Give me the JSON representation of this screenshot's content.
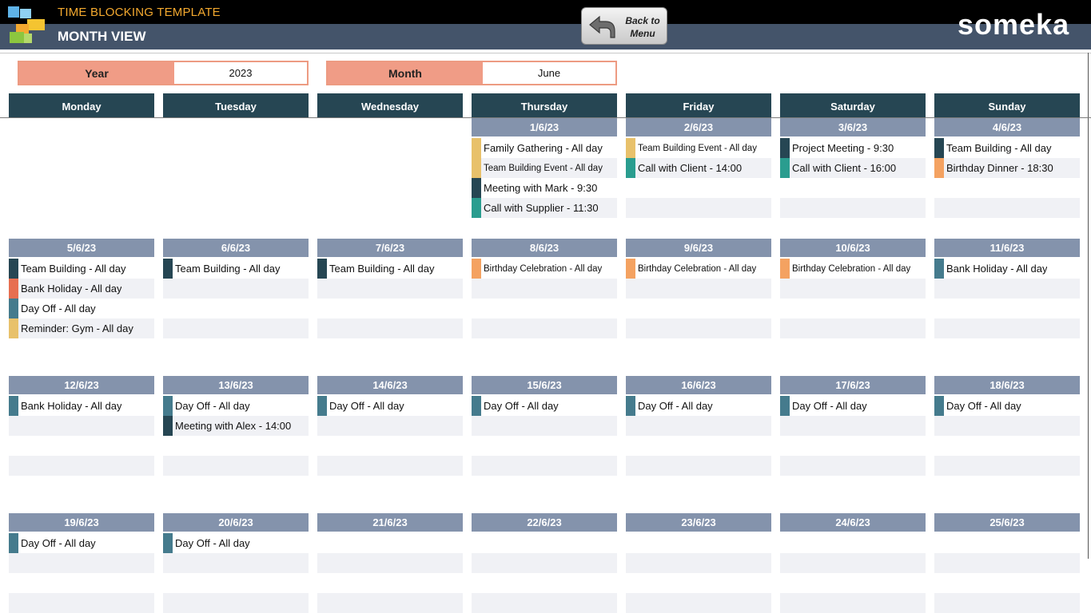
{
  "header": {
    "app_title": "TIME BLOCKING TEMPLATE",
    "view_title": "MONTH VIEW",
    "back_button_line1": "Back to",
    "back_button_line2": "Menu",
    "brand": "someka"
  },
  "filters": {
    "year_label": "Year",
    "year_value": "2023",
    "month_label": "Month",
    "month_value": "June"
  },
  "weekdays": [
    "Monday",
    "Tuesday",
    "Wednesday",
    "Thursday",
    "Friday",
    "Saturday",
    "Sunday"
  ],
  "colors": {
    "yellow": "#e8c16b",
    "navy": "#264653",
    "teal": "#2a9d8f",
    "orange": "#f4a261",
    "red": "#e76f51",
    "steel": "#457b8d"
  },
  "weeks": [
    [
      null,
      null,
      null,
      {
        "date": "1/6/23",
        "events": [
          {
            "text": "Family Gathering - All day",
            "color": "yellow"
          },
          {
            "text": "Team Building Event - All day",
            "color": "yellow",
            "small": true
          },
          {
            "text": "Meeting with Mark - 9:30",
            "color": "navy"
          },
          {
            "text": "Call with Supplier - 11:30",
            "color": "teal"
          }
        ]
      },
      {
        "date": "2/6/23",
        "events": [
          {
            "text": "Team Building Event - All day",
            "color": "yellow",
            "small": true
          },
          {
            "text": "Call with Client - 14:00",
            "color": "teal"
          }
        ]
      },
      {
        "date": "3/6/23",
        "events": [
          {
            "text": "Project Meeting - 9:30",
            "color": "navy"
          },
          {
            "text": "Call with Client - 16:00",
            "color": "teal"
          }
        ]
      },
      {
        "date": "4/6/23",
        "events": [
          {
            "text": "Team Building - All day",
            "color": "navy"
          },
          {
            "text": "Birthday Dinner - 18:30",
            "color": "orange"
          }
        ]
      }
    ],
    [
      {
        "date": "5/6/23",
        "events": [
          {
            "text": "Team Building - All day",
            "color": "navy"
          },
          {
            "text": "Bank Holiday - All day",
            "color": "red"
          },
          {
            "text": "Day Off - All day",
            "color": "steel"
          },
          {
            "text": "Reminder: Gym - All day",
            "color": "yellow"
          }
        ]
      },
      {
        "date": "6/6/23",
        "events": [
          {
            "text": "Team Building - All day",
            "color": "navy"
          }
        ]
      },
      {
        "date": "7/6/23",
        "events": [
          {
            "text": "Team Building - All day",
            "color": "navy"
          }
        ]
      },
      {
        "date": "8/6/23",
        "events": [
          {
            "text": "Birthday Celebration - All day",
            "color": "orange",
            "small": true
          }
        ]
      },
      {
        "date": "9/6/23",
        "events": [
          {
            "text": "Birthday Celebration - All day",
            "color": "orange",
            "small": true
          }
        ]
      },
      {
        "date": "10/6/23",
        "events": [
          {
            "text": "Birthday Celebration - All day",
            "color": "orange",
            "small": true
          }
        ]
      },
      {
        "date": "11/6/23",
        "events": [
          {
            "text": "Bank Holiday - All day",
            "color": "steel"
          }
        ]
      }
    ],
    [
      {
        "date": "12/6/23",
        "events": [
          {
            "text": "Bank Holiday - All day",
            "color": "steel"
          }
        ]
      },
      {
        "date": "13/6/23",
        "events": [
          {
            "text": "Day Off - All day",
            "color": "steel"
          },
          {
            "text": "Meeting with Alex - 14:00",
            "color": "navy"
          }
        ]
      },
      {
        "date": "14/6/23",
        "events": [
          {
            "text": "Day Off - All day",
            "color": "steel"
          }
        ]
      },
      {
        "date": "15/6/23",
        "events": [
          {
            "text": "Day Off - All day",
            "color": "steel"
          }
        ]
      },
      {
        "date": "16/6/23",
        "events": [
          {
            "text": "Day Off - All day",
            "color": "steel"
          }
        ]
      },
      {
        "date": "17/6/23",
        "events": [
          {
            "text": "Day Off - All day",
            "color": "steel"
          }
        ]
      },
      {
        "date": "18/6/23",
        "events": [
          {
            "text": "Day Off - All day",
            "color": "steel"
          }
        ]
      }
    ],
    [
      {
        "date": "19/6/23",
        "events": [
          {
            "text": "Day Off - All day",
            "color": "steel"
          }
        ]
      },
      {
        "date": "20/6/23",
        "events": [
          {
            "text": "Day Off - All day",
            "color": "steel"
          }
        ]
      },
      {
        "date": "21/6/23",
        "events": []
      },
      {
        "date": "22/6/23",
        "events": []
      },
      {
        "date": "23/6/23",
        "events": []
      },
      {
        "date": "24/6/23",
        "events": []
      },
      {
        "date": "25/6/23",
        "events": []
      }
    ]
  ]
}
